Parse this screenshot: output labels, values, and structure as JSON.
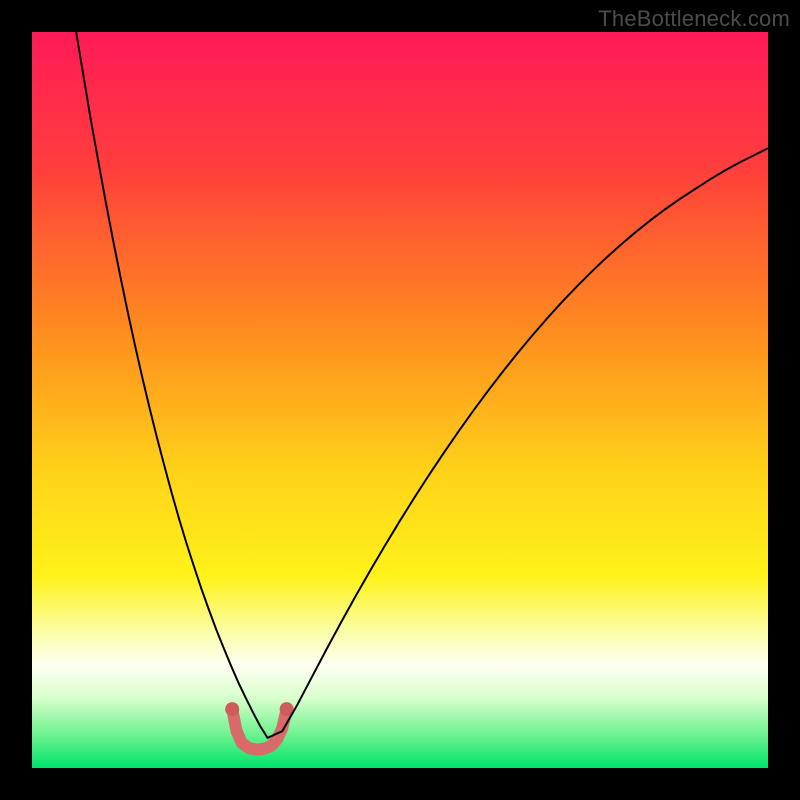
{
  "watermark": "TheBottleneck.com",
  "chart_data": {
    "type": "line",
    "title": "",
    "xlabel": "",
    "ylabel": "",
    "xlim": [
      0,
      100
    ],
    "ylim": [
      0,
      100
    ],
    "gradient_stops": [
      {
        "offset": 0.0,
        "color": "#ff1a58"
      },
      {
        "offset": 0.18,
        "color": "#ff3d3d"
      },
      {
        "offset": 0.4,
        "color": "#ff8a1f"
      },
      {
        "offset": 0.6,
        "color": "#ffd31a"
      },
      {
        "offset": 0.74,
        "color": "#fff21a"
      },
      {
        "offset": 0.82,
        "color": "#faffb0"
      },
      {
        "offset": 0.86,
        "color": "#fffff2"
      },
      {
        "offset": 0.905,
        "color": "#d8ffcc"
      },
      {
        "offset": 0.955,
        "color": "#6cf28f"
      },
      {
        "offset": 1.0,
        "color": "#00e36b"
      }
    ],
    "series": [
      {
        "name": "bottleneck-curve",
        "type": "line",
        "color": "#000000",
        "stroke_width": 2,
        "x": [
          6,
          7,
          8,
          9,
          10,
          11,
          12,
          13,
          14,
          15,
          16,
          17,
          18,
          19,
          20,
          21,
          22,
          23,
          24,
          25,
          26,
          27,
          28,
          29,
          30,
          31,
          32,
          34,
          36,
          38,
          40,
          42,
          44,
          46,
          48,
          50,
          52,
          54,
          56,
          58,
          60,
          62,
          64,
          66,
          68,
          70,
          72,
          74,
          76,
          78,
          80,
          82,
          84,
          86,
          88,
          90,
          92,
          94,
          96,
          98,
          100
        ],
        "y": [
          100,
          94,
          88,
          82.5,
          77,
          71.8,
          66.8,
          62,
          57.4,
          53,
          48.8,
          44.8,
          41,
          37.3,
          33.8,
          30.5,
          27.4,
          24.4,
          21.6,
          18.9,
          16.4,
          14,
          11.7,
          9.6,
          7.6,
          5.7,
          4.1,
          5.0,
          8.5,
          12.3,
          16.1,
          19.8,
          23.4,
          26.9,
          30.3,
          33.6,
          36.8,
          39.9,
          42.9,
          45.8,
          48.6,
          51.3,
          53.9,
          56.4,
          58.8,
          61.1,
          63.3,
          65.4,
          67.4,
          69.3,
          71.1,
          72.8,
          74.4,
          75.9,
          77.3,
          78.6,
          79.9,
          81.1,
          82.2,
          83.2,
          84.2
        ]
      },
      {
        "name": "valley-marker",
        "type": "line",
        "color": "#d86a6a",
        "stroke_width": 12,
        "linecap": "round",
        "x": [
          27.2,
          27.8,
          28.5,
          29.5,
          30.5,
          31.5,
          32.5,
          33.3,
          34.0,
          34.6
        ],
        "y": [
          8.0,
          5.0,
          3.4,
          2.7,
          2.5,
          2.6,
          3.0,
          3.9,
          5.4,
          8.0
        ]
      }
    ],
    "valley_dots": {
      "color": "#cf5c5c",
      "radius": 7,
      "points": [
        {
          "x": 27.2,
          "y": 8.0
        },
        {
          "x": 34.6,
          "y": 8.0
        }
      ]
    }
  }
}
